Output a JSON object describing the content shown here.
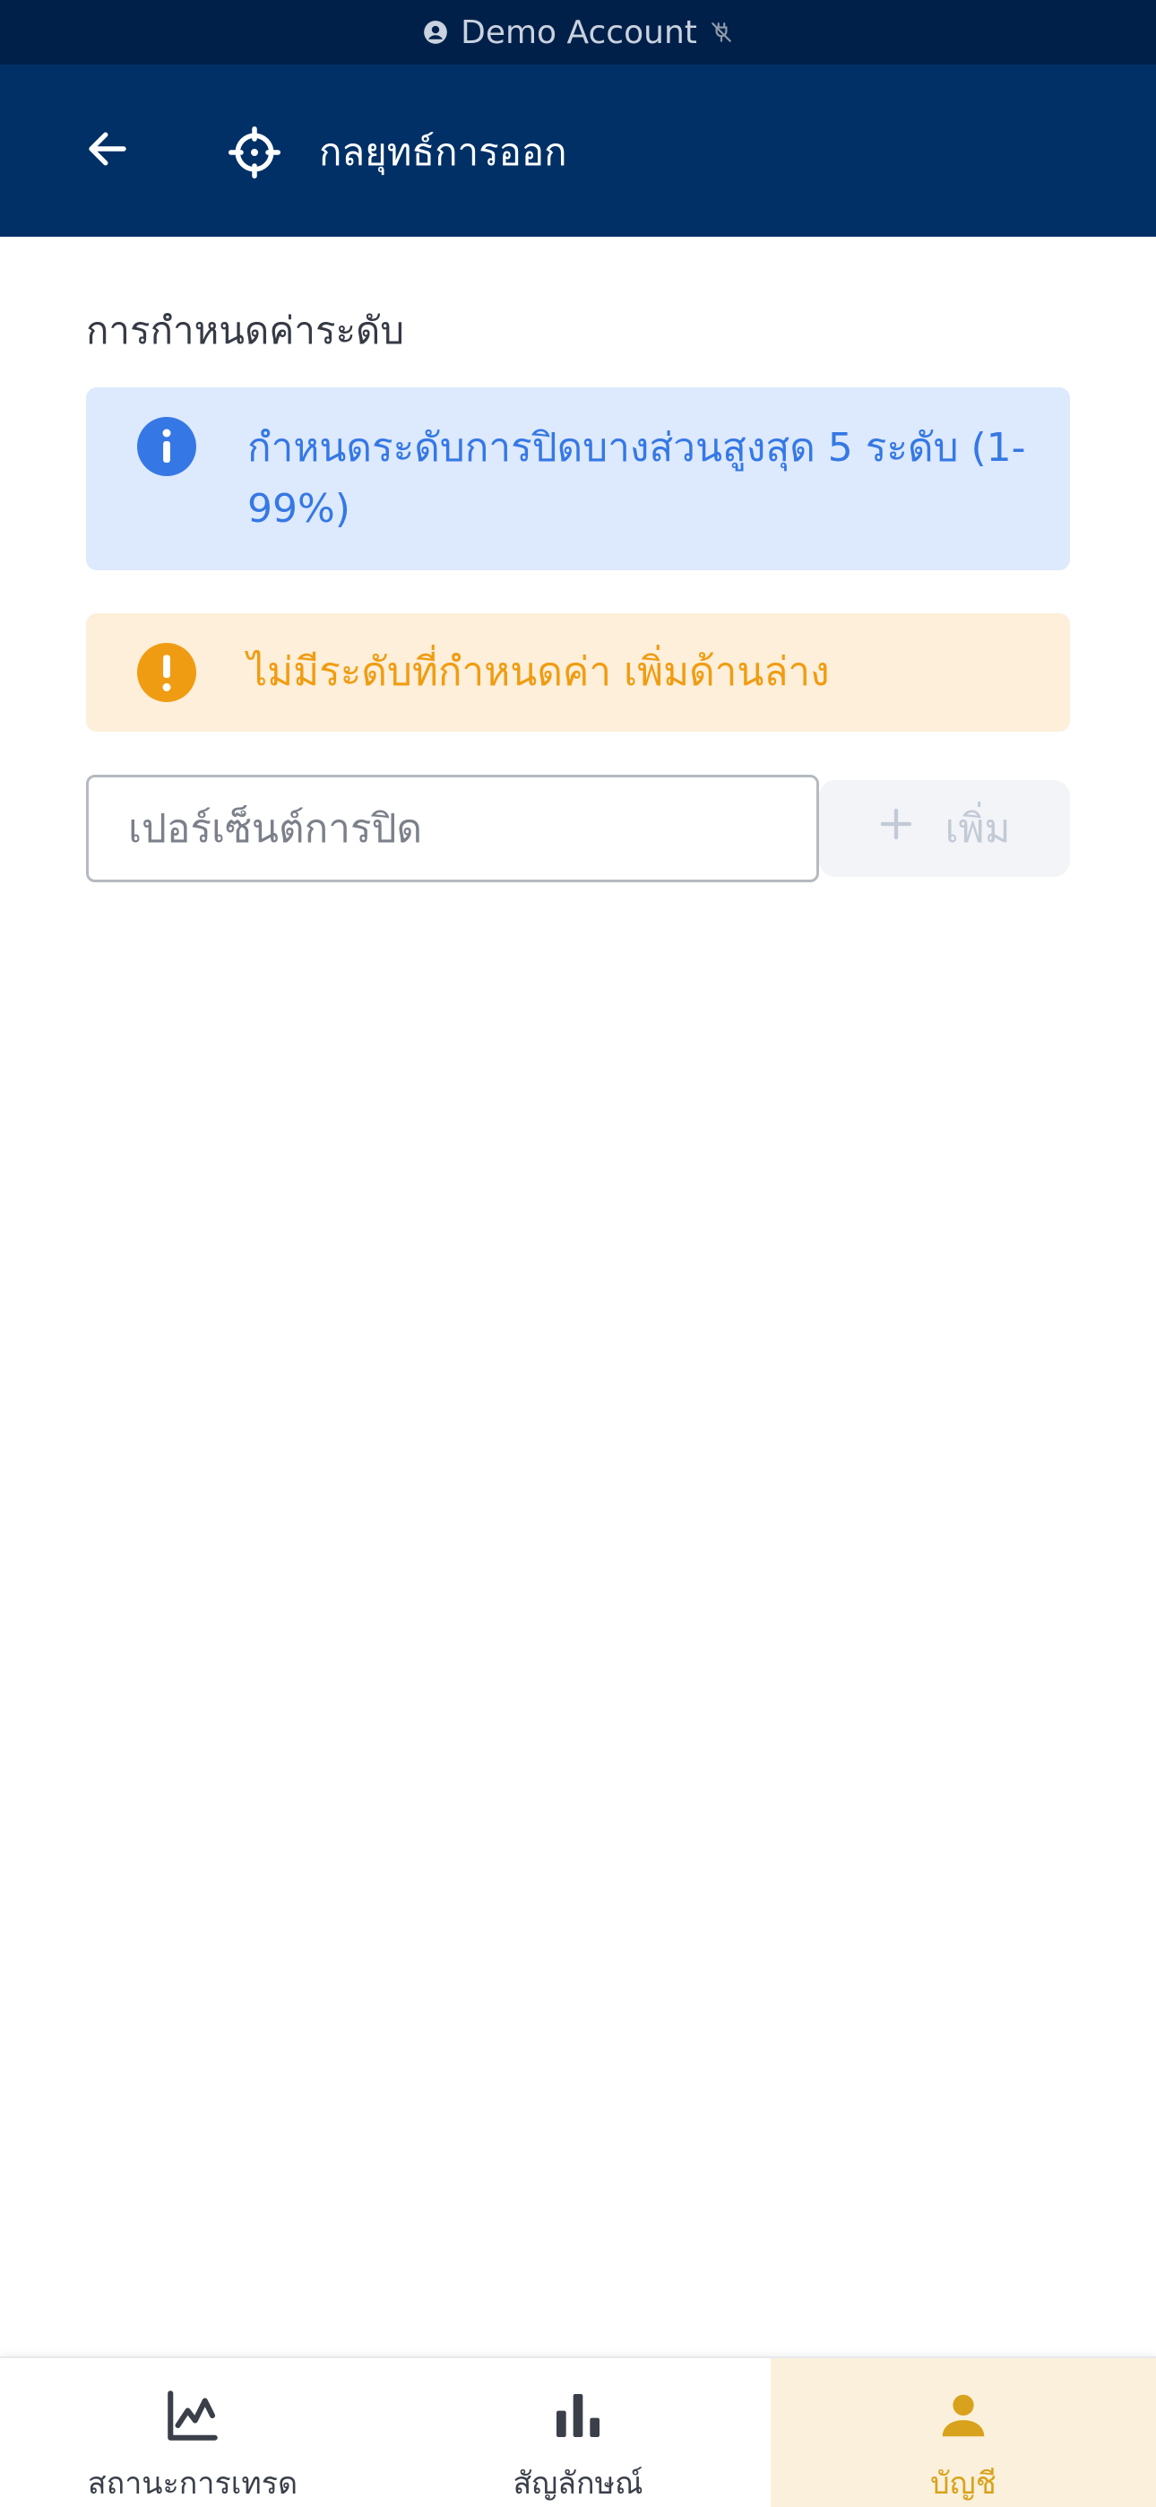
{
  "demo_strip": {
    "label": "Demo Account"
  },
  "header": {
    "title": "กลยุทธ์การออก"
  },
  "section": {
    "label": "การกำหนดค่าระดับ"
  },
  "info_alert": {
    "text": "กำหนดระดับการปิดบางส่วนสูงสุด 5 ระดับ (1-99%)"
  },
  "warning_alert": {
    "text": "ไม่มีระดับที่กำหนดค่า เพิ่มด้านล่าง"
  },
  "form": {
    "percent_input_value": "",
    "percent_input_placeholder": "เปอร์เซ็นต์การปิด",
    "add_button_label": "เพิ่ม"
  },
  "bottom_nav": {
    "items": [
      {
        "label": "สถานะการเทรด",
        "icon": "line-chart-icon",
        "active": false
      },
      {
        "label": "สัญลักษณ์",
        "icon": "bar-chart-icon",
        "active": false
      },
      {
        "label": "บัญชี",
        "icon": "user-icon",
        "active": true
      }
    ]
  },
  "colors": {
    "header_bg": "#003066",
    "demo_strip_bg": "#012049",
    "info_bg": "#dde9fc",
    "info_accent": "#3578e5",
    "warning_bg": "#fdefd9",
    "warning_accent": "#f09c12",
    "nav_active_bg": "#faf0dc",
    "nav_active_accent": "#d9a21c"
  }
}
